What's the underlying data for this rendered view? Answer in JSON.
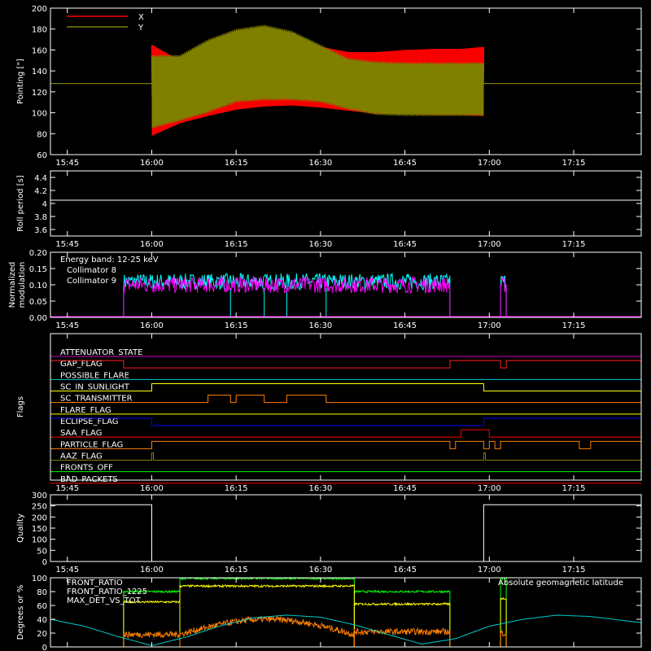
{
  "chart_data": [
    {
      "type": "line",
      "ylabel": "Pointing [\"]",
      "ylim": [
        60,
        200
      ],
      "yticks": [
        60,
        80,
        100,
        120,
        140,
        160,
        180,
        200
      ],
      "xlim": [
        "15:42",
        "17:27"
      ],
      "xticks": [
        "15:45",
        "16:00",
        "16:15",
        "16:30",
        "16:45",
        "17:00",
        "17:15"
      ],
      "legend_position": "top-left",
      "series": [
        {
          "name": "X",
          "color": "#ff0000",
          "envelope_time": [
            "16:00",
            "16:05",
            "16:10",
            "16:15",
            "16:20",
            "16:25",
            "16:30",
            "16:35",
            "16:40",
            "16:45",
            "16:50",
            "16:55",
            "16:59"
          ],
          "envelope_upper": [
            165,
            150,
            160,
            168,
            172,
            170,
            163,
            158,
            158,
            160,
            161,
            161,
            163
          ],
          "envelope_lower": [
            78,
            90,
            97,
            103,
            106,
            107,
            105,
            102,
            99,
            99,
            98,
            98,
            97
          ],
          "constant_before": 128,
          "constant_after": 128
        },
        {
          "name": "Y",
          "color": "#808000",
          "envelope_time": [
            "16:00",
            "16:05",
            "16:10",
            "16:15",
            "16:20",
            "16:25",
            "16:30",
            "16:35",
            "16:40",
            "16:45",
            "16:50",
            "16:55",
            "16:59"
          ],
          "envelope_upper": [
            155,
            155,
            170,
            180,
            184,
            178,
            165,
            152,
            149,
            148,
            148,
            148,
            148
          ],
          "envelope_lower": [
            85,
            92,
            100,
            110,
            112,
            112,
            110,
            103,
            98,
            97,
            97,
            97,
            97
          ],
          "constant_before": 128,
          "constant_after": 128
        }
      ]
    },
    {
      "type": "line",
      "ylabel": "Roll period [s]",
      "ylim": [
        3.5,
        4.5
      ],
      "yticks": [
        3.6,
        3.8,
        4.0,
        4.2,
        4.4
      ],
      "xticks": [
        "15:45",
        "16:00",
        "16:15",
        "16:30",
        "16:45",
        "17:00",
        "17:15"
      ],
      "series": [
        {
          "name": "",
          "color": "#ffffff",
          "value": 4.05
        }
      ]
    },
    {
      "type": "line",
      "ylabel": "Normalized modulation",
      "ylim": [
        0,
        0.2
      ],
      "yticks": [
        "0.00",
        "0.05",
        "0.10",
        "0.15",
        "0.20"
      ],
      "xticks": [
        "15:45",
        "16:00",
        "16:15",
        "16:30",
        "16:45",
        "17:00",
        "17:15"
      ],
      "annotation": "Energy band: 12-25 keV",
      "series": [
        {
          "name": "Collimator 8",
          "color": "#00ffff",
          "level": 0.1,
          "active": [
            [
              "15:55",
              "16:53"
            ],
            [
              "17:02",
              "17:03"
            ]
          ],
          "dropouts": [
            "16:14",
            "16:20",
            "16:24",
            "16:31"
          ]
        },
        {
          "name": "Collimator 9",
          "color": "#ff00ff",
          "level": 0.1,
          "active": [
            [
              "15:55",
              "16:53"
            ],
            [
              "17:02",
              "17:03"
            ]
          ]
        }
      ]
    },
    {
      "type": "step",
      "ylabel": "Flags",
      "xticks": [
        "15:45",
        "16:00",
        "16:15",
        "16:30",
        "16:45",
        "17:00",
        "17:15"
      ],
      "flags": [
        {
          "name": "ATTENUATOR_STATE",
          "color": "#cc00cc",
          "on": []
        },
        {
          "name": "GAP_FLAG",
          "color": "#ff2020",
          "on": [
            [
              "15:42",
              "15:55"
            ],
            [
              "16:53",
              "17:02"
            ],
            [
              "17:03",
              "17:27"
            ]
          ]
        },
        {
          "name": "POSSIBLE_FLARE",
          "color": "#00cccc",
          "on": []
        },
        {
          "name": "SC_IN_SUNLIGHT",
          "color": "#ffff00",
          "on": [
            [
              "16:00",
              "16:59"
            ]
          ]
        },
        {
          "name": "SC_TRANSMITTER",
          "color": "#ff8000",
          "on": [
            [
              "16:10",
              "16:14"
            ],
            [
              "16:15",
              "16:20"
            ],
            [
              "16:24",
              "16:31"
            ]
          ]
        },
        {
          "name": "FLARE_FLAG",
          "color": "#ffff00",
          "on": []
        },
        {
          "name": "ECLIPSE_FLAG",
          "color": "#0000ff",
          "on": [
            [
              "15:42",
              "16:00"
            ],
            [
              "16:59",
              "17:27"
            ]
          ]
        },
        {
          "name": "SAA_FLAG",
          "color": "#ff0000",
          "on": [
            [
              "16:55",
              "17:00"
            ]
          ]
        },
        {
          "name": "PARTICLE_FLAG",
          "color": "#ff8000",
          "on": [
            [
              "16:00",
              "16:53"
            ],
            [
              "16:54",
              "16:59"
            ],
            [
              "17:00",
              "17:01"
            ],
            [
              "17:02",
              "17:16"
            ],
            [
              "17:18",
              "17:27"
            ]
          ]
        },
        {
          "name": "AAZ_FLAG",
          "color": "#808000",
          "on": [
            [
              "16:00",
              "16:00.3"
            ],
            [
              "16:59",
              "16:59.3"
            ]
          ]
        },
        {
          "name": "FRONTS_OFF",
          "color": "#00ff00",
          "on": []
        },
        {
          "name": "BAD_PACKETS",
          "color": "#ff0000",
          "on": []
        }
      ]
    },
    {
      "type": "line",
      "ylabel": "Quality",
      "ylim": [
        0,
        300
      ],
      "yticks": [
        0,
        50,
        100,
        150,
        200,
        250,
        300
      ],
      "xticks": [
        "15:45",
        "16:00",
        "16:15",
        "16:30",
        "16:45",
        "17:00",
        "17:15"
      ],
      "series": [
        {
          "name": "",
          "color": "#ffffff",
          "segments": [
            [
              "15:42",
              "16:00",
              255
            ],
            [
              "16:00",
              "16:59",
              0
            ],
            [
              "16:59",
              "17:27",
              255
            ]
          ]
        }
      ]
    },
    {
      "type": "line",
      "ylabel": "Degrees or %",
      "ylim": [
        0,
        100
      ],
      "yticks": [
        0,
        20,
        40,
        60,
        80,
        100
      ],
      "xticks": [
        "15:45",
        "16:00",
        "16:15",
        "16:30",
        "16:45",
        "17:00",
        "17:15"
      ],
      "annotation": "Absolute geomagnetic latitude",
      "series": [
        {
          "name": "FRONT_RATIO",
          "color": "#00ff00",
          "segments": [
            [
              "15:55",
              "16:05",
              80
            ],
            [
              "16:05",
              "16:36",
              99
            ],
            [
              "16:36",
              "16:53",
              80
            ],
            [
              "17:02",
              "17:03",
              99
            ]
          ]
        },
        {
          "name": "FRONT_RATIO_1225",
          "color": "#ffff00",
          "segments": [
            [
              "15:55",
              "16:05",
              65
            ],
            [
              "16:05",
              "16:36",
              88
            ],
            [
              "16:36",
              "16:53",
              62
            ],
            [
              "17:02",
              "17:03",
              70
            ]
          ]
        },
        {
          "name": "MAX_DET_VS_TOT",
          "color": "#ff8000",
          "segments": [
            [
              "15:55",
              "16:05",
              18
            ],
            [
              "16:05",
              "16:36",
              30
            ],
            [
              "16:36",
              "16:53",
              22
            ],
            [
              "17:02",
              "17:03",
              20
            ]
          ]
        },
        {
          "name": "Absolute geomagnetic latitude",
          "color": "#00cccc",
          "time": [
            "15:42",
            "15:48",
            "15:54",
            "16:00",
            "16:06",
            "16:12",
            "16:18",
            "16:24",
            "16:30",
            "16:36",
            "16:42",
            "16:48",
            "16:54",
            "17:00",
            "17:06",
            "17:12",
            "17:18",
            "17:24",
            "17:27"
          ],
          "values": [
            40,
            30,
            15,
            2,
            14,
            30,
            42,
            46,
            43,
            32,
            18,
            4,
            12,
            30,
            40,
            46,
            44,
            38,
            35
          ]
        }
      ]
    }
  ]
}
